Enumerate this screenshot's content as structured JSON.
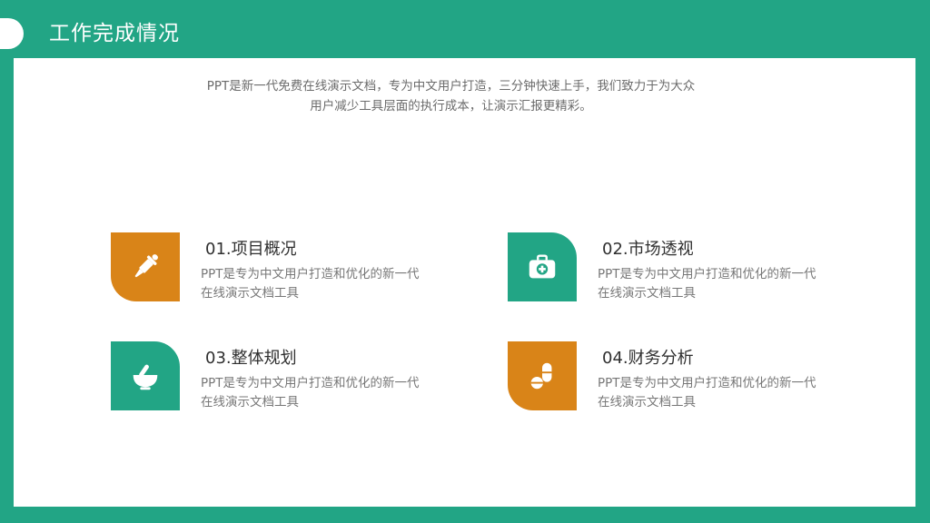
{
  "header": {
    "title": "工作完成情况"
  },
  "intro": {
    "line1": "PPT是新一代免费在线演示文档，专为中文用户打造，三分钟快速上手，我们致力于为大众",
    "line2": "用户减少工具层面的执行成本，让演示汇报更精彩。"
  },
  "colors": {
    "green": "#22a585",
    "orange": "#d98418"
  },
  "items": [
    {
      "title": "01.项目概况",
      "desc": "PPT是专为中文用户打造和优化的新一代在线演示文档工具",
      "icon": "dropper-icon",
      "color": "#d98418"
    },
    {
      "title": "02.市场透视",
      "desc": "PPT是专为中文用户打造和优化的新一代在线演示文档工具",
      "icon": "medkit-icon",
      "color": "#22a585"
    },
    {
      "title": "03.整体规划",
      "desc": "PPT是专为中文用户打造和优化的新一代在线演示文档工具",
      "icon": "mortar-icon",
      "color": "#22a585"
    },
    {
      "title": "04.财务分析",
      "desc": "PPT是专为中文用户打造和优化的新一代在线演示文档工具",
      "icon": "pills-icon",
      "color": "#d98418"
    }
  ]
}
